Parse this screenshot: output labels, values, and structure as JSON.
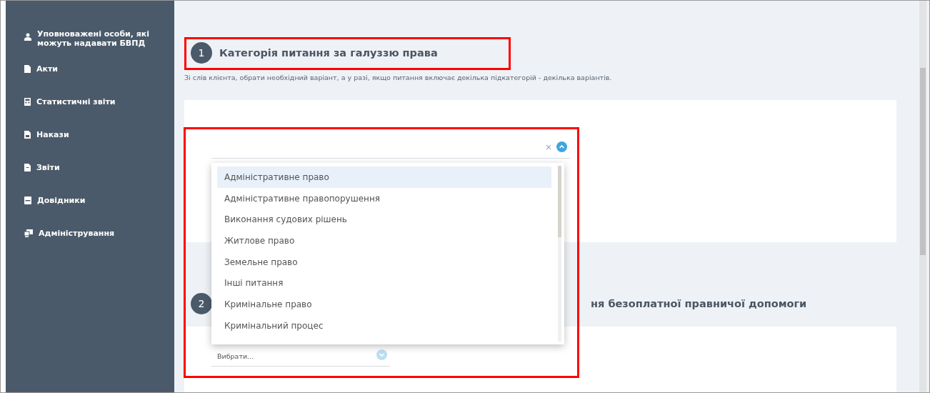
{
  "sidebar": {
    "items": [
      {
        "label": "Уповноважені особи, які можуть надавати БВПД"
      },
      {
        "label": "Акти"
      },
      {
        "label": "Статистичні звіти"
      },
      {
        "label": "Накази"
      },
      {
        "label": "Звіти"
      },
      {
        "label": "Довідники"
      },
      {
        "label": "Адміністрування"
      }
    ]
  },
  "sections": [
    {
      "number": "1",
      "title": "Категорія питання за галуззю права",
      "highlighted": true,
      "description": "Зі слів клієнта, обрати необхідний варіант, а у разі, якщо питання включає декілька підкатегорій - декілька варіантів.",
      "select": {
        "open": true,
        "highlighted": true,
        "clear": "×",
        "options": [
          {
            "label": "Адміністративне право",
            "selected": true
          },
          {
            "label": "Адміністративне правопорушення",
            "selected": false
          },
          {
            "label": "Виконання судових рішень",
            "selected": false
          },
          {
            "label": "Житлове право",
            "selected": false
          },
          {
            "label": "Земельне право",
            "selected": false
          },
          {
            "label": "Інші питання",
            "selected": false
          },
          {
            "label": "Кримінальне право",
            "selected": false
          },
          {
            "label": "Кримінальний процес",
            "selected": false
          }
        ]
      }
    },
    {
      "number": "2",
      "title": "ня безоплатної правничої допомоги",
      "select": {
        "open": false,
        "placeholder": "Вибрати..."
      }
    }
  ]
}
